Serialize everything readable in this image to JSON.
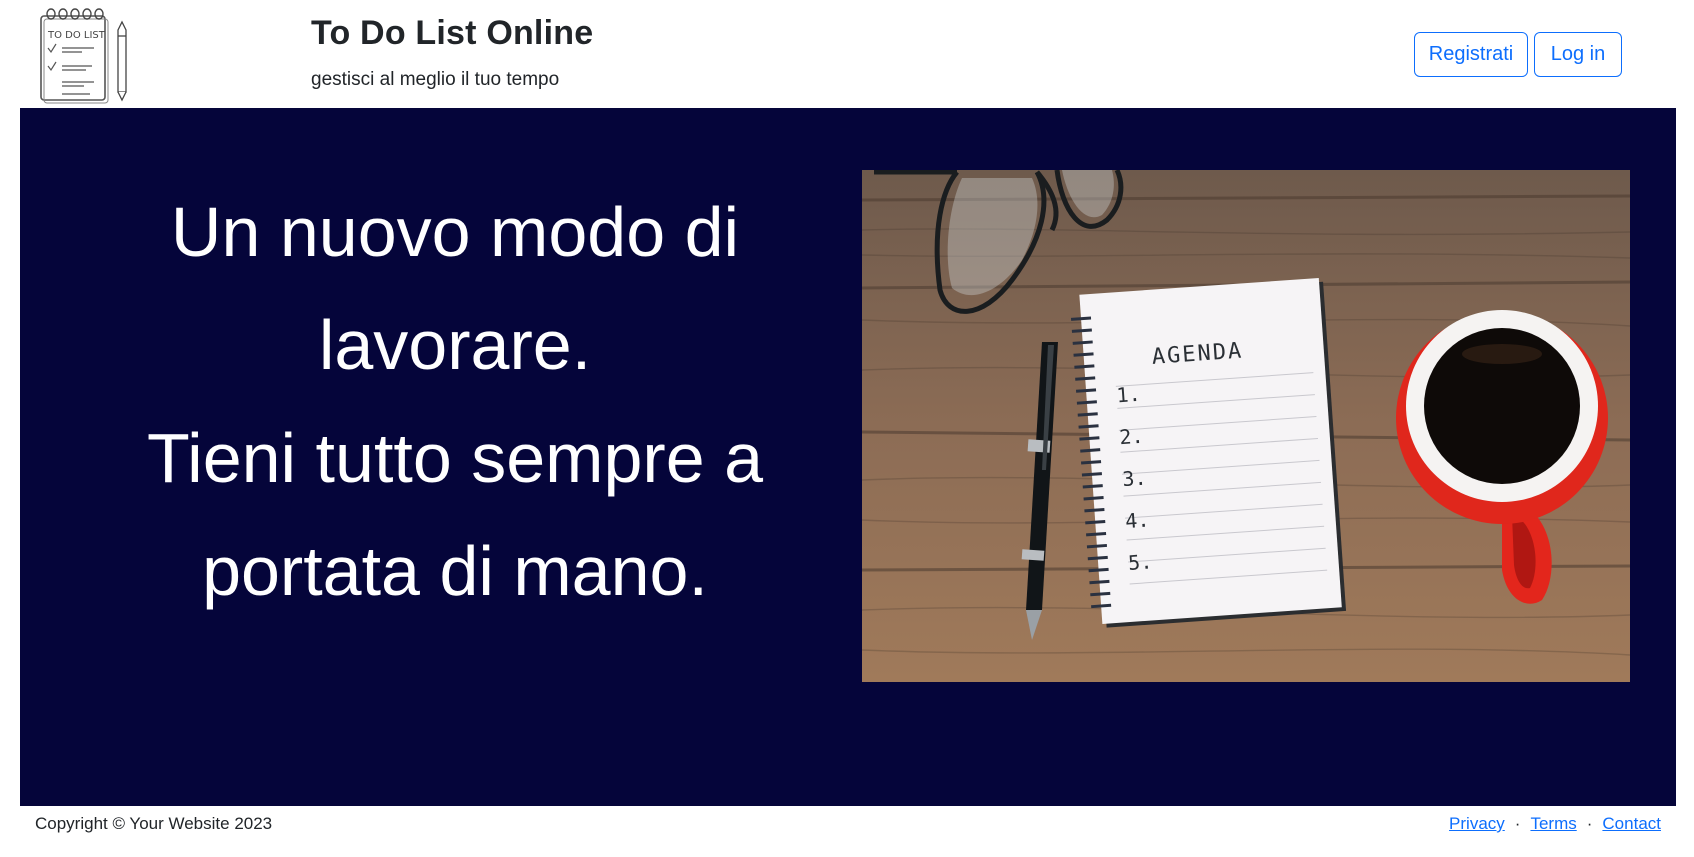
{
  "header": {
    "title": "To Do List Online",
    "subtitle": "gestisci al meglio il tuo tempo",
    "logo_text": "TO DO LIST",
    "register_label": "Registrati",
    "login_label": "Log in"
  },
  "hero": {
    "lines": [
      "Un nuovo modo di",
      "lavorare.",
      "Tieni tutto sempre a",
      "portata di mano."
    ],
    "image": {
      "notebook_title": "AGENDA",
      "list_numbers": [
        "1.",
        "2.",
        "3.",
        "4.",
        "5."
      ]
    }
  },
  "footer": {
    "copyright": "Copyright © Your Website 2023",
    "links": [
      "Privacy",
      "Terms",
      "Contact"
    ],
    "separator": "·"
  },
  "colors": {
    "hero_background": "#05053a",
    "accent": "#0d6efd",
    "text": "#212529"
  }
}
